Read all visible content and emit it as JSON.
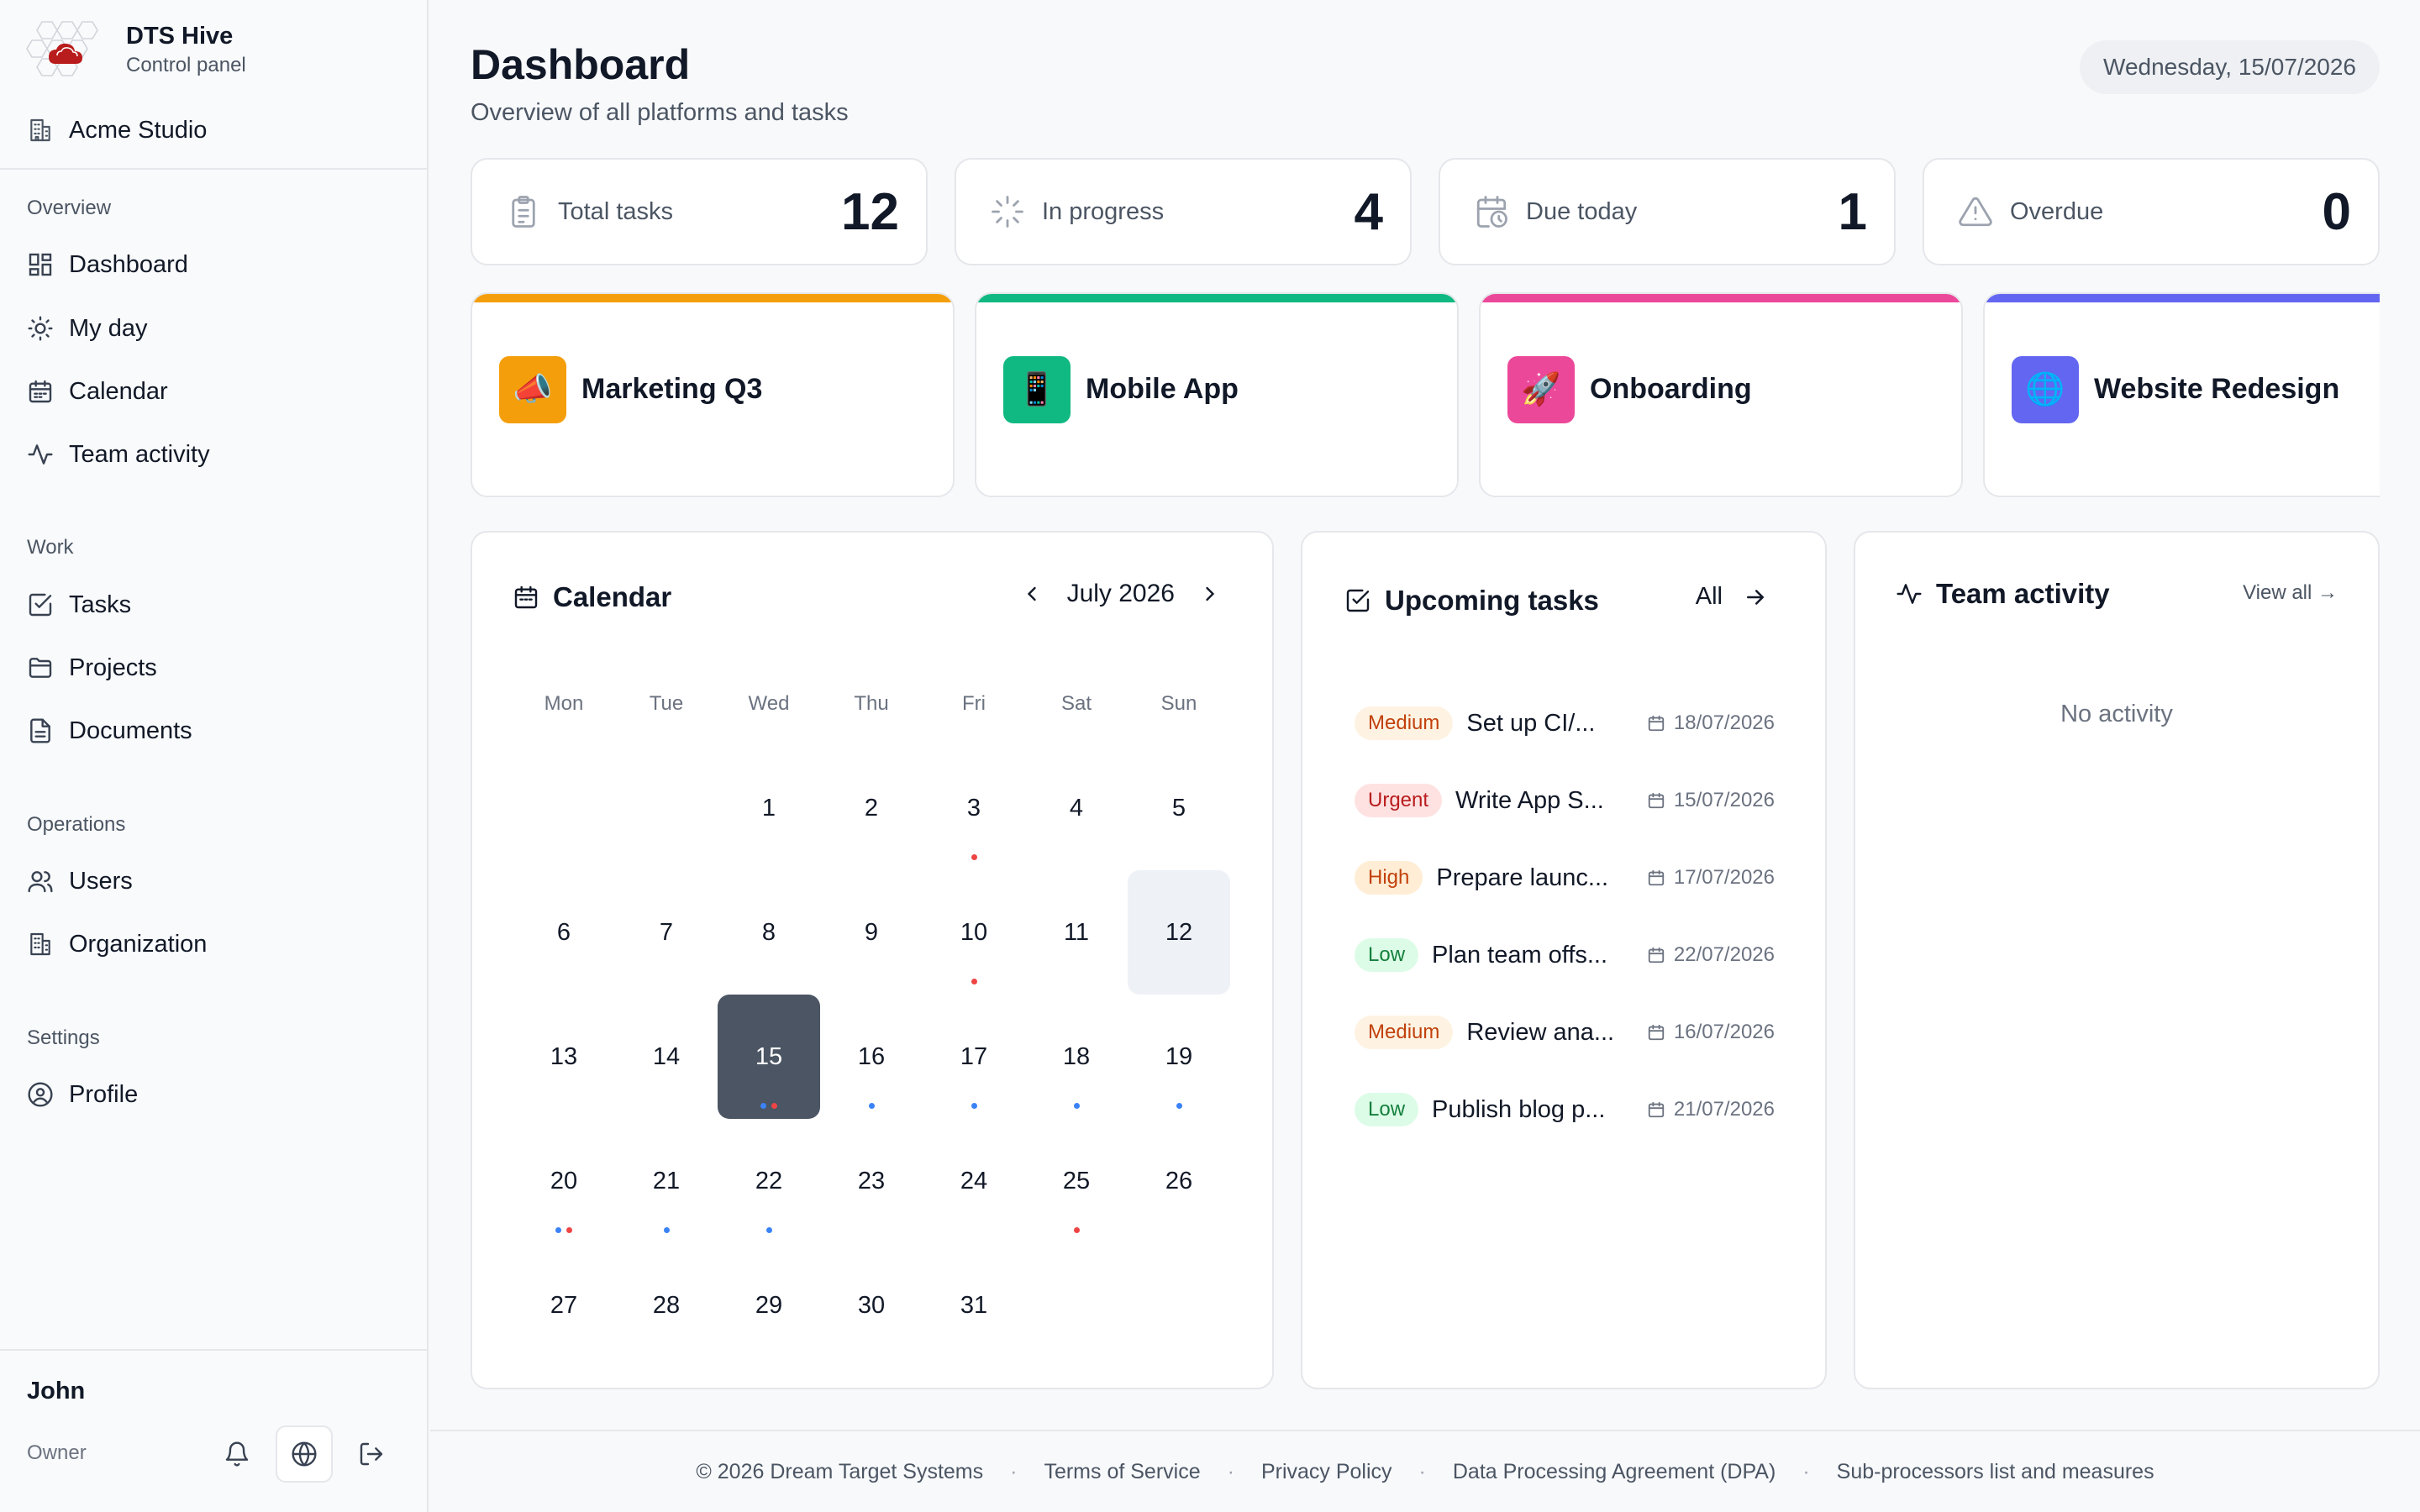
{
  "brand": {
    "name": "DTS Hive",
    "subtitle": "Control panel"
  },
  "organization": "Acme Studio",
  "sidebar": {
    "sections": [
      {
        "label": "Overview",
        "items": [
          {
            "label": "Dashboard",
            "icon": "dashboard-icon"
          },
          {
            "label": "My day",
            "icon": "sun-icon"
          },
          {
            "label": "Calendar",
            "icon": "calendar-icon"
          },
          {
            "label": "Team activity",
            "icon": "activity-icon"
          }
        ]
      },
      {
        "label": "Work",
        "items": [
          {
            "label": "Tasks",
            "icon": "check-square-icon"
          },
          {
            "label": "Projects",
            "icon": "folder-icon"
          },
          {
            "label": "Documents",
            "icon": "document-icon"
          }
        ]
      },
      {
        "label": "Operations",
        "items": [
          {
            "label": "Users",
            "icon": "users-icon"
          },
          {
            "label": "Organization",
            "icon": "building-icon"
          }
        ]
      },
      {
        "label": "Settings",
        "items": [
          {
            "label": "Profile",
            "icon": "user-circle-icon"
          }
        ]
      }
    ]
  },
  "user": {
    "name": "John",
    "role": "Owner"
  },
  "header": {
    "title": "Dashboard",
    "subtitle": "Overview of all platforms and tasks",
    "date": "Wednesday, 15/07/2026"
  },
  "stats": [
    {
      "label": "Total tasks",
      "value": "12",
      "icon": "clipboard-icon"
    },
    {
      "label": "In progress",
      "value": "4",
      "icon": "loader-icon"
    },
    {
      "label": "Due today",
      "value": "1",
      "icon": "calendar-clock-icon"
    },
    {
      "label": "Overdue",
      "value": "0",
      "icon": "alert-triangle-icon"
    }
  ],
  "projects": [
    {
      "name": "Marketing Q3",
      "emoji": "📣",
      "color": "#f59e0b"
    },
    {
      "name": "Mobile App",
      "emoji": "📱",
      "color": "#10b981"
    },
    {
      "name": "Onboarding",
      "emoji": "🚀",
      "color": "#ec4899"
    },
    {
      "name": "Website Redesign",
      "emoji": "🌐",
      "color": "#6366f1"
    }
  ],
  "calendar": {
    "title": "Calendar",
    "month": "July 2026",
    "weekdays": [
      "Mon",
      "Tue",
      "Wed",
      "Thu",
      "Fri",
      "Sat",
      "Sun"
    ],
    "first_weekday_index": 2,
    "days_in_month": 31,
    "today": 15,
    "selected": 12,
    "dots": {
      "3": [
        "#ef4444"
      ],
      "10": [
        "#ef4444"
      ],
      "15": [
        "#3b82f6",
        "#ef4444"
      ],
      "16": [
        "#3b82f6"
      ],
      "17": [
        "#3b82f6"
      ],
      "18": [
        "#3b82f6"
      ],
      "19": [
        "#3b82f6"
      ],
      "20": [
        "#3b82f6",
        "#ef4444"
      ],
      "21": [
        "#3b82f6"
      ],
      "22": [
        "#3b82f6"
      ],
      "25": [
        "#ef4444"
      ]
    }
  },
  "upcoming": {
    "title": "Upcoming tasks",
    "all_label": "All",
    "tasks": [
      {
        "priority": "Medium",
        "title": "Set up CI/...",
        "date": "18/07/2026"
      },
      {
        "priority": "Urgent",
        "title": "Write App S...",
        "date": "15/07/2026"
      },
      {
        "priority": "High",
        "title": "Prepare launc...",
        "date": "17/07/2026"
      },
      {
        "priority": "Low",
        "title": "Plan team offs...",
        "date": "22/07/2026"
      },
      {
        "priority": "Medium",
        "title": "Review ana...",
        "date": "16/07/2026"
      },
      {
        "priority": "Low",
        "title": "Publish blog p...",
        "date": "21/07/2026"
      }
    ]
  },
  "priority_styles": {
    "Medium": {
      "bg": "#fef3e2",
      "fg": "#c2410c"
    },
    "Urgent": {
      "bg": "#fee2e2",
      "fg": "#b91c1c"
    },
    "High": {
      "bg": "#ffedd5",
      "fg": "#c2410c"
    },
    "Low": {
      "bg": "#dcfce7",
      "fg": "#15803d"
    }
  },
  "activity": {
    "title": "Team activity",
    "view_all": "View all →",
    "empty": "No activity"
  },
  "footer": {
    "links": [
      "© 2026 Dream Target Systems",
      "Terms of Service",
      "Privacy Policy",
      "Data Processing Agreement (DPA)",
      "Sub-processors list and measures"
    ],
    "separator": "·"
  }
}
